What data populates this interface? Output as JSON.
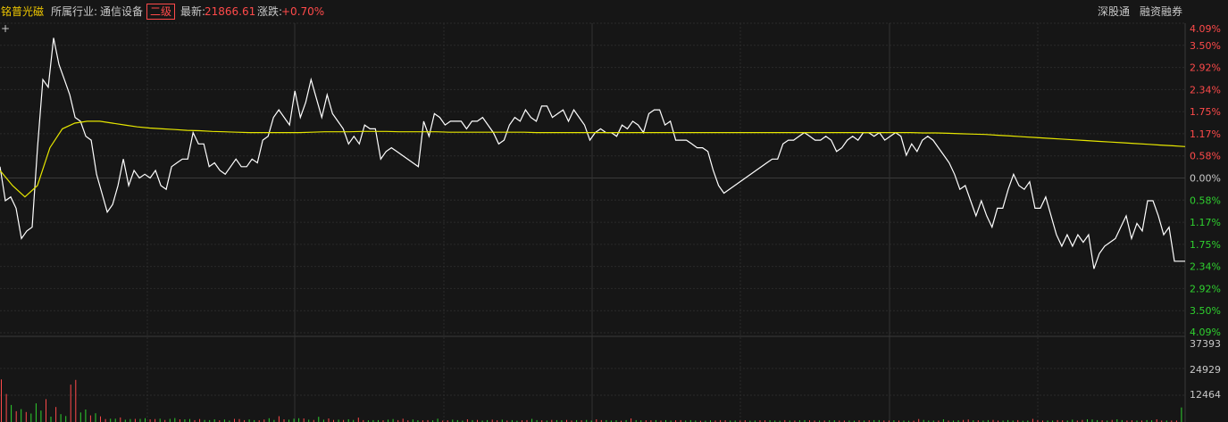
{
  "header": {
    "stock_name": "铭普光磁",
    "industry_label": "所属行业:",
    "industry_value": "通信设备",
    "industry_tag": "二级",
    "latest_label": "最新:",
    "latest_value": "21866.61",
    "change_label": "涨跌:",
    "change_value": "+0.70%",
    "link_shenzhen": "深股通",
    "link_margin": "融资融券"
  },
  "crosshair_icon": "+",
  "colors": {
    "background": "#161616",
    "up": "#ff4a4a",
    "down": "#2fd12f",
    "price_line": "#ffffff",
    "avg_line": "#e6e600",
    "grid": "#2a2a2a",
    "zero": "#3a3a3a"
  },
  "chart_data": [
    {
      "type": "line",
      "y_axis_labels_up": [
        "4.09%",
        "3.50%",
        "2.92%",
        "2.34%",
        "1.75%",
        "1.17%",
        "0.58%"
      ],
      "y_axis_zero": "0.00%",
      "y_axis_labels_down": [
        "0.58%",
        "1.17%",
        "1.75%",
        "2.34%",
        "2.92%",
        "3.50%",
        "4.09%"
      ],
      "ylim": [
        -4.09,
        4.09
      ],
      "series": [
        {
          "values": [
            0.3,
            -0.6,
            -0.5,
            -0.8,
            -1.6,
            -1.4,
            -1.3,
            0.8,
            2.6,
            2.4,
            3.7,
            3.0,
            2.6,
            2.2,
            1.6,
            1.5,
            1.1,
            1.0,
            0.1,
            -0.4,
            -0.9,
            -0.7,
            -0.2,
            0.5,
            -0.2,
            0.2,
            0.0,
            0.1,
            0.0,
            0.2,
            -0.2,
            -0.3,
            0.3,
            0.4,
            0.5,
            0.5,
            1.2,
            0.9,
            0.9,
            0.3,
            0.4,
            0.2,
            0.1,
            0.3,
            0.5,
            0.3,
            0.3,
            0.5,
            0.4,
            1.0,
            1.1,
            1.6,
            1.8,
            1.6,
            1.4,
            2.3,
            1.6,
            2.0,
            2.6,
            2.1,
            1.6,
            2.2,
            1.7,
            1.5,
            1.3,
            0.9,
            1.1,
            0.9,
            1.4,
            1.3,
            1.3,
            0.5,
            0.7,
            0.8,
            0.7,
            0.6,
            0.5,
            0.4,
            0.3,
            1.5,
            1.1,
            1.7,
            1.6,
            1.4,
            1.5,
            1.5,
            1.5,
            1.3,
            1.5,
            1.5,
            1.6,
            1.4,
            1.2,
            0.9,
            1.0,
            1.4,
            1.6,
            1.5,
            1.8,
            1.6,
            1.5,
            1.9,
            1.9,
            1.6,
            1.7,
            1.8,
            1.5,
            1.8,
            1.6,
            1.4,
            1.0,
            1.2,
            1.3,
            1.2,
            1.2,
            1.1,
            1.4,
            1.3,
            1.5,
            1.4,
            1.2,
            1.7,
            1.8,
            1.8,
            1.4,
            1.5,
            1.0,
            1.0,
            1.0,
            0.9,
            0.8,
            0.8,
            0.7,
            0.2,
            -0.2,
            -0.4,
            -0.3,
            -0.2,
            -0.1,
            0.0,
            0.1,
            0.2,
            0.3,
            0.4,
            0.5,
            0.5,
            0.9,
            1.0,
            1.0,
            1.1,
            1.2,
            1.1,
            1.0,
            1.0,
            1.1,
            1.0,
            0.7,
            0.8,
            1.0,
            1.1,
            1.0,
            1.2,
            1.2,
            1.1,
            1.2,
            1.0,
            1.1,
            1.2,
            1.1,
            0.6,
            0.9,
            0.7,
            1.0,
            1.1,
            1.0,
            0.8,
            0.6,
            0.4,
            0.1,
            -0.3,
            -0.2,
            -0.6,
            -1.0,
            -0.6,
            -1.0,
            -1.3,
            -0.8,
            -0.8,
            -0.3,
            0.1,
            -0.2,
            -0.3,
            -0.1,
            -0.8,
            -0.8,
            -0.5,
            -1.0,
            -1.5,
            -1.8,
            -1.5,
            -1.8,
            -1.5,
            -1.7,
            -1.5,
            -2.4,
            -2.0,
            -1.8,
            -1.7,
            -1.6,
            -1.3,
            -1.0,
            -1.6,
            -1.2,
            -1.4,
            -0.6,
            -0.6,
            -1.0,
            -1.5,
            -1.3,
            -2.2,
            -2.2,
            -2.2
          ]
        },
        {
          "values": [
            0.2,
            -0.2,
            -0.5,
            -0.2,
            0.8,
            1.3,
            1.45,
            1.5,
            1.5,
            1.45,
            1.4,
            1.35,
            1.32,
            1.3,
            1.28,
            1.26,
            1.25,
            1.23,
            1.22,
            1.21,
            1.2,
            1.2,
            1.2,
            1.2,
            1.2,
            1.21,
            1.22,
            1.22,
            1.22,
            1.23,
            1.23,
            1.23,
            1.22,
            1.22,
            1.22,
            1.22,
            1.21,
            1.21,
            1.21,
            1.21,
            1.21,
            1.21,
            1.21,
            1.2,
            1.2,
            1.2,
            1.2,
            1.2,
            1.2,
            1.2,
            1.2,
            1.2,
            1.2,
            1.2,
            1.2,
            1.2,
            1.2,
            1.2,
            1.2,
            1.2,
            1.2,
            1.2,
            1.2,
            1.2,
            1.2,
            1.2,
            1.2,
            1.2,
            1.2,
            1.2,
            1.2,
            1.2,
            1.2,
            1.2,
            1.19,
            1.19,
            1.18,
            1.17,
            1.16,
            1.15,
            1.13,
            1.11,
            1.09,
            1.07,
            1.05,
            1.03,
            1.01,
            0.99,
            0.97,
            0.95,
            0.93,
            0.91,
            0.89,
            0.87,
            0.85,
            0.83
          ]
        }
      ]
    },
    {
      "type": "bar",
      "y_axis_labels": [
        "37393",
        "24929",
        "12464"
      ],
      "ylim": [
        0,
        37393
      ],
      "values": [
        20500,
        13500,
        8200,
        5200,
        6200,
        4800,
        4100,
        9000,
        5500,
        11000,
        2600,
        7200,
        3800,
        2900,
        18000,
        20300,
        4600,
        6000,
        3200,
        4200,
        2700,
        1400,
        1600,
        1600,
        2200,
        1100,
        1400,
        1500,
        1500,
        1800,
        1300,
        1400,
        1600,
        1000,
        1500,
        1900,
        1300,
        1300,
        1400,
        900,
        1400,
        1000,
        900,
        1300,
        800,
        1200,
        700,
        1500,
        1400,
        900,
        1200,
        900,
        800,
        1200,
        1800,
        1000,
        2800,
        1300,
        1100,
        1600,
        1800,
        1700,
        1100,
        1000,
        2500,
        1100,
        1700,
        1000,
        1100,
        1000,
        1300,
        1000,
        2100,
        900,
        800,
        900,
        900,
        800,
        1100,
        1400,
        900,
        1600,
        800,
        1200,
        800,
        800,
        900,
        800,
        1600,
        700,
        800,
        1100,
        900,
        700,
        1300,
        900,
        1000,
        700,
        900,
        1100,
        800,
        1100,
        700,
        900,
        600,
        800,
        900,
        1500,
        900,
        800,
        700,
        1000,
        900,
        800,
        1000,
        700,
        900,
        800,
        1000,
        700,
        1300,
        900,
        900,
        700,
        800,
        600,
        900,
        1700,
        900,
        800,
        800,
        800,
        900,
        700,
        900,
        700,
        800,
        900,
        700,
        900,
        700,
        600,
        600,
        800,
        700,
        900,
        800,
        700,
        700,
        700,
        800,
        600,
        700,
        800,
        800,
        800,
        700,
        600,
        900,
        700,
        700,
        800,
        900,
        800,
        700,
        700,
        700,
        800,
        800,
        700,
        700,
        700,
        600,
        800,
        700,
        800,
        900,
        900,
        700,
        700,
        800,
        700,
        700,
        600,
        600,
        1400,
        1000,
        700,
        700,
        700,
        1300,
        700,
        700,
        800,
        1000,
        1200,
        800,
        800,
        700,
        900,
        1000,
        700,
        700,
        900,
        700,
        900,
        600,
        700,
        1500,
        900,
        700,
        700,
        700,
        900,
        800,
        700,
        1100,
        700,
        1000,
        1300,
        1200,
        900,
        800,
        700,
        1000,
        1300,
        900,
        700,
        800,
        700,
        700,
        900,
        800,
        1300,
        700,
        700,
        700,
        700,
        7000
      ],
      "colors": "rrgrgrgggrgrggrrggrgrrggrggrggrrgrggrggrrgggrggrrrggrrggrrgggrgrggrrgrggrrgggrggrrrggrrggrrgggrgrggrrgrggrrggrgrggrrgrggrrgggrgrggrrgrggrrgggrggrrrggrrggrrgggrgrggrrgrggrrggrgrggrrgrggrrgggrgrggrrgrggrrgggrggrrrggrrggrrgggrgrggrrgrggrrg"
    }
  ]
}
